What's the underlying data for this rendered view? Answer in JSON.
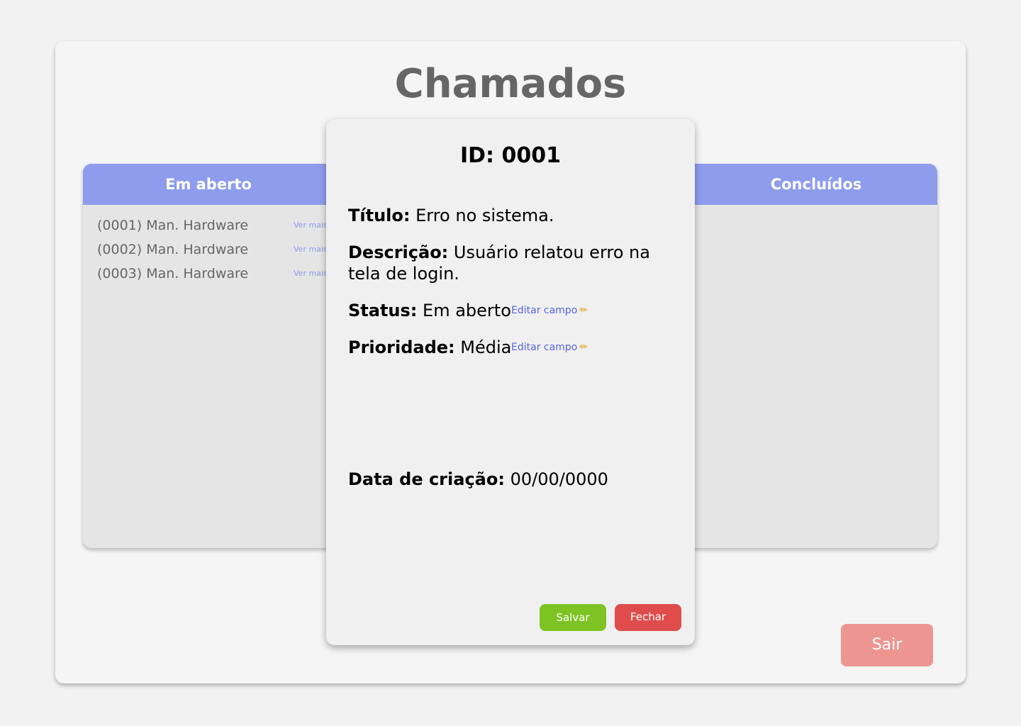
{
  "page": {
    "title": "Chamados"
  },
  "columns": {
    "open": {
      "header": "Em aberto",
      "items": [
        {
          "label": "(0001) Man. Hardware",
          "more": "Ver mais"
        },
        {
          "label": "(0002) Man. Hardware",
          "more": "Ver mais"
        },
        {
          "label": "(0003) Man. Hardware",
          "more": "Ver mais"
        }
      ]
    },
    "done": {
      "header": "Concluídos",
      "items": []
    }
  },
  "modal": {
    "id_label": "ID:",
    "id_value": "0001",
    "title_label": "Título:",
    "title_value": "Erro no sistema.",
    "desc_label": "Descrição:",
    "desc_value": "Usuário relatou erro na tela de login.",
    "status_label": "Status:",
    "status_value": "Em aberto",
    "priority_label": "Prioridade:",
    "priority_value": "Média",
    "edit_label": "Editar campo",
    "date_label": "Data de criação:",
    "date_value": "00/00/0000",
    "save_label": "Salvar",
    "close_label": "Fechar"
  },
  "footer": {
    "exit_label": "Sair"
  },
  "colors": {
    "header_accent": "#8e9ced",
    "save": "#7cc323",
    "close": "#e04c4c",
    "exit": "#ec9591"
  },
  "icons": {
    "edit": "pencil-icon"
  }
}
